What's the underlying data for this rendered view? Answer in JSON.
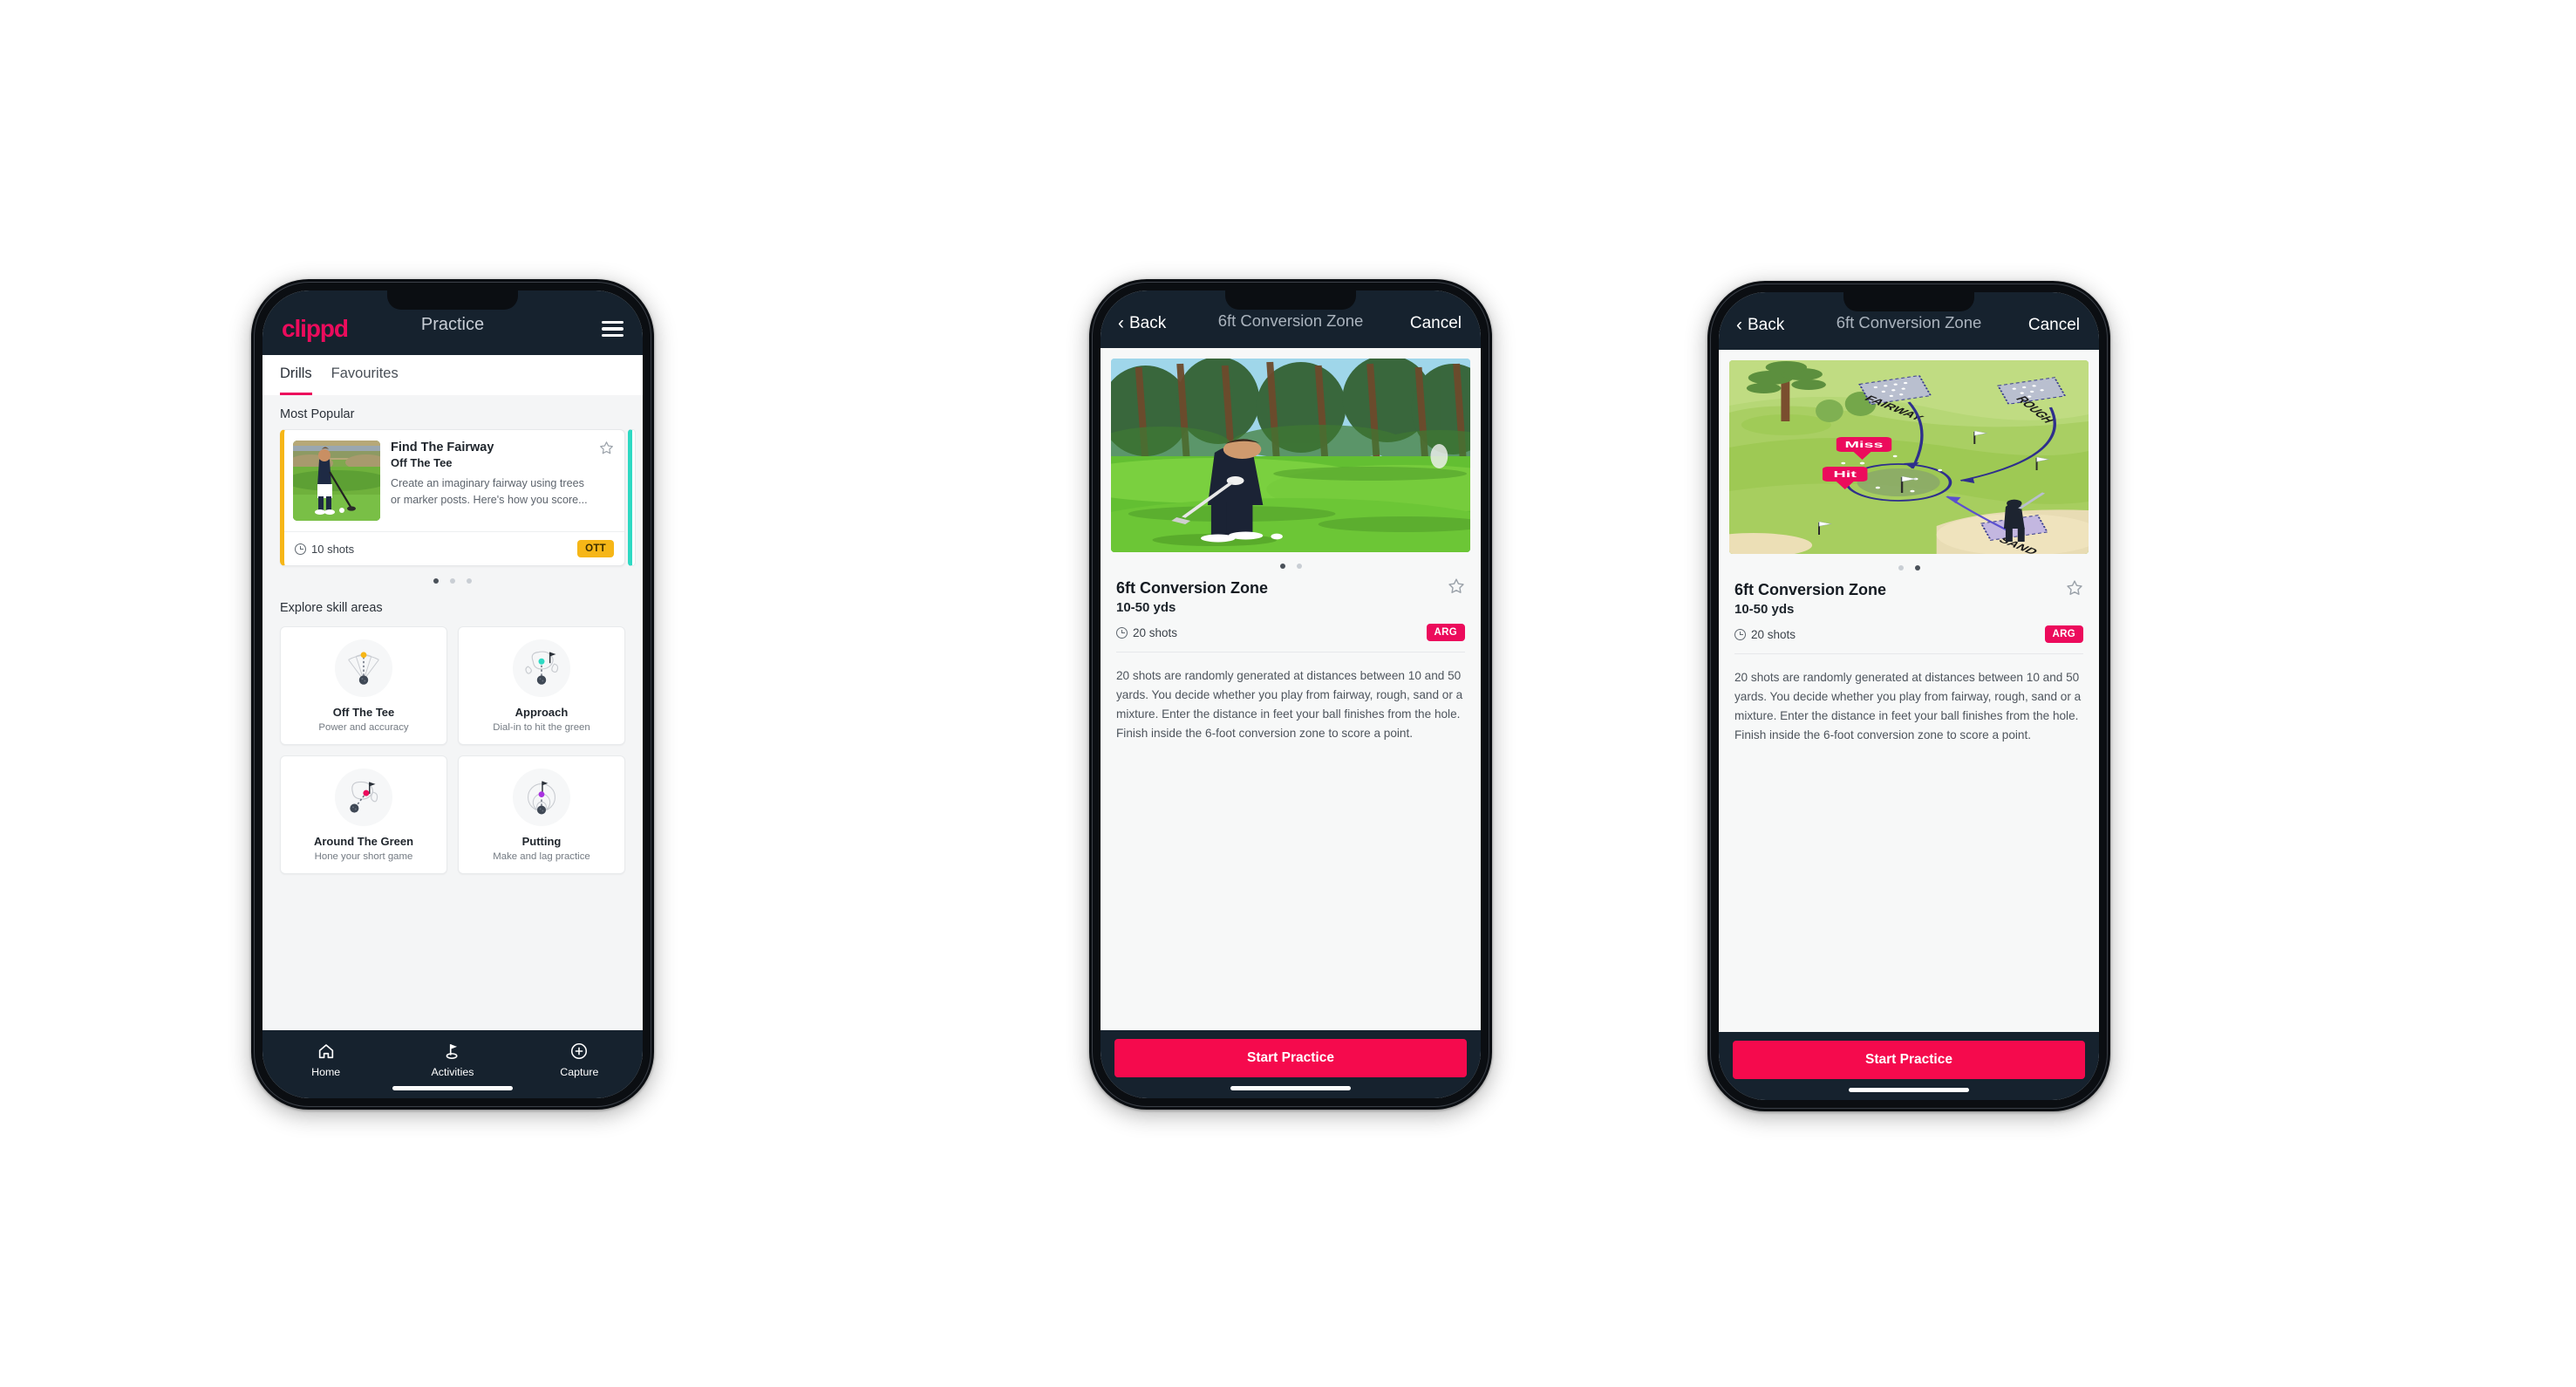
{
  "app": {
    "logo_text": "clippd",
    "accent_pink": "#ec0b5c",
    "cta_pink": "#f50a4d",
    "dark_navy": "#16222e",
    "badge_amber": "#f6b617",
    "teal": "#2ed9c3"
  },
  "phone1": {
    "header": {
      "logo": "clippd",
      "title": "Practice",
      "menu_icon": "hamburger-menu-icon"
    },
    "tabs": [
      {
        "label": "Drills",
        "active": true
      },
      {
        "label": "Favourites",
        "active": false
      }
    ],
    "most_popular": {
      "section_title": "Most Popular",
      "card": {
        "title": "Find The Fairway",
        "subtitle": "Off The Tee",
        "description": "Create an imaginary fairway using trees or marker posts. Here's how you score...",
        "shots": "10 shots",
        "badge": "OTT",
        "badge_color": "#f6b617",
        "favourite_icon": "star-outline-icon",
        "thumbnail": "golfer-teeing-off-photo"
      },
      "pager": {
        "count": 3,
        "active_index": 0
      }
    },
    "skills": {
      "section_title": "Explore skill areas",
      "items": [
        {
          "name": "Off The Tee",
          "desc": "Power and accuracy",
          "icon": "tee-shot-fan-icon",
          "dot_color": "#f6b617"
        },
        {
          "name": "Approach",
          "desc": "Dial-in to hit the green",
          "icon": "approach-green-icon",
          "dot_color": "#2ed9c3"
        },
        {
          "name": "Around The Green",
          "desc": "Hone your short game",
          "icon": "around-green-icon",
          "dot_color": "#ec0b5c"
        },
        {
          "name": "Putting",
          "desc": "Make and lag practice",
          "icon": "putting-rings-icon",
          "dot_color": "#a932e0"
        }
      ]
    },
    "bottom_nav": [
      {
        "label": "Home",
        "icon": "home-icon",
        "active": false
      },
      {
        "label": "Activities",
        "icon": "golf-flag-icon",
        "active": true
      },
      {
        "label": "Capture",
        "icon": "plus-circle-icon",
        "active": false
      }
    ]
  },
  "phone2": {
    "navbar": {
      "back": "Back",
      "title": "6ft Conversion Zone",
      "cancel": "Cancel",
      "back_icon": "chevron-left-icon"
    },
    "hero": "golfer-chipping-photo",
    "pager": {
      "count": 2,
      "active_index": 0
    },
    "detail": {
      "title": "6ft Conversion Zone",
      "subtitle": "10-50 yds",
      "shots": "20 shots",
      "badge": "ARG",
      "favourite_icon": "star-outline-icon",
      "description": "20 shots are randomly generated at distances between 10 and 50 yards. You decide whether you play from fairway, rough, sand or a mixture. Enter the distance in feet your ball finishes from the hole. Finish inside the 6-foot conversion zone to score a point."
    },
    "cta": "Start Practice"
  },
  "phone3": {
    "navbar": {
      "back": "Back",
      "title": "6ft Conversion Zone",
      "cancel": "Cancel",
      "back_icon": "chevron-left-icon"
    },
    "hero": "golf-course-diagram-illustration",
    "illustration": {
      "zone_labels": [
        "FAIRWAY",
        "ROUGH",
        "SAND"
      ],
      "callouts": [
        {
          "text": "Miss",
          "color": "#ec0b5c"
        },
        {
          "text": "Hit",
          "color": "#ec0b5c"
        }
      ]
    },
    "pager": {
      "count": 2,
      "active_index": 1
    },
    "detail": {
      "title": "6ft Conversion Zone",
      "subtitle": "10-50 yds",
      "shots": "20 shots",
      "badge": "ARG",
      "favourite_icon": "star-outline-icon",
      "description": "20 shots are randomly generated at distances between 10 and 50 yards. You decide whether you play from fairway, rough, sand or a mixture. Enter the distance in feet your ball finishes from the hole. Finish inside the 6-foot conversion zone to score a point."
    },
    "cta": "Start Practice"
  }
}
